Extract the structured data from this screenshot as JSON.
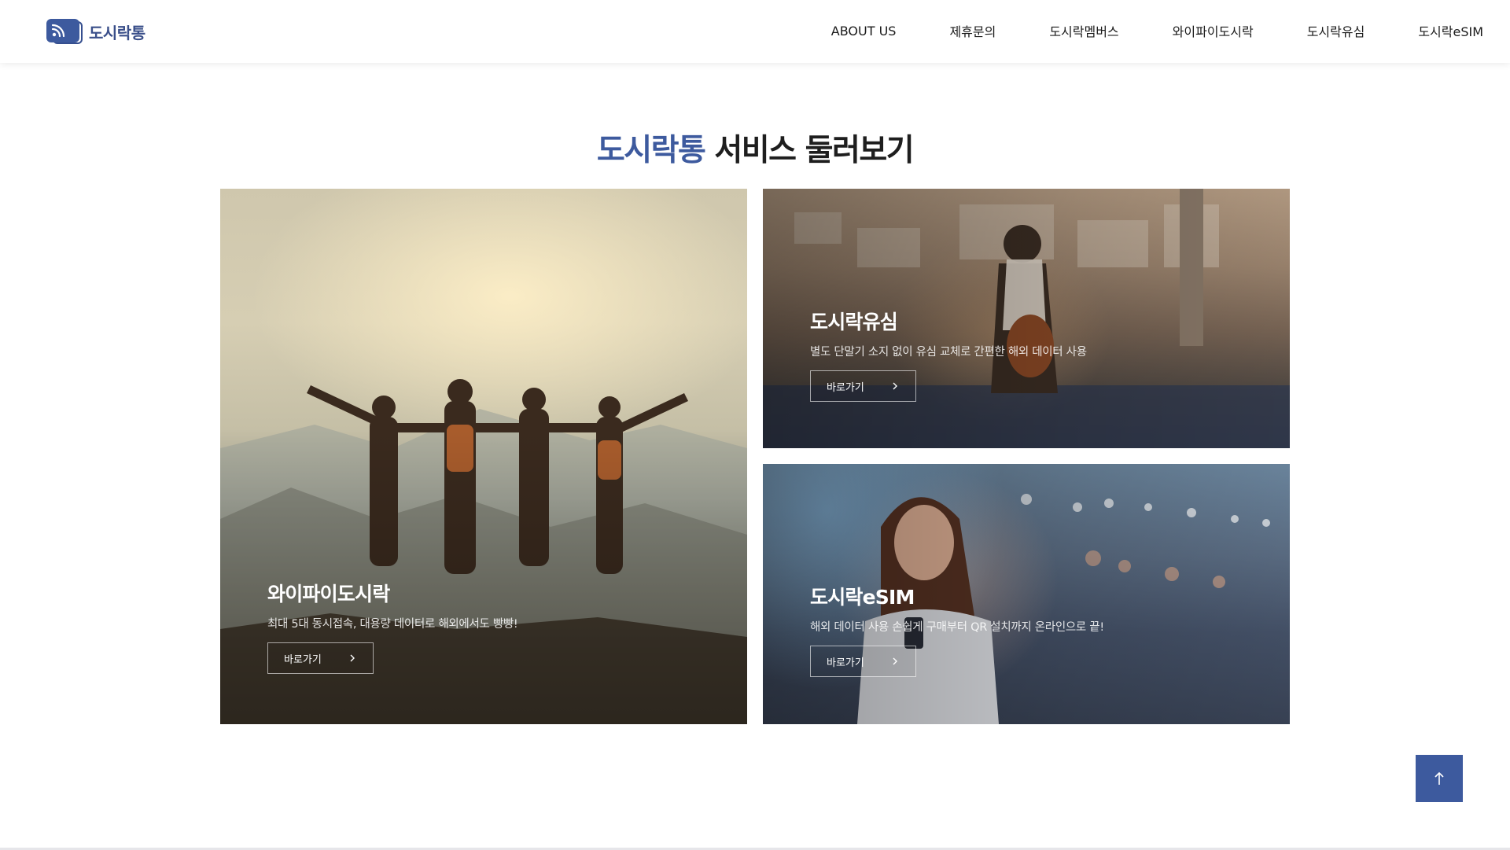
{
  "header": {
    "logo_text": "도시락통",
    "nav": [
      {
        "label": "ABOUT US"
      },
      {
        "label": "제휴문의"
      },
      {
        "label": "도시락멤버스"
      },
      {
        "label": "와이파이도시락"
      },
      {
        "label": "도시락유심"
      },
      {
        "label": "도시락eSIM"
      }
    ]
  },
  "section": {
    "title_accent": "도시락통",
    "title_rest": " 서비스 둘러보기"
  },
  "cards": [
    {
      "title": "와이파이도시락",
      "description": "최대 5대 동시접속, 대용량 데이터로 해외에서도 빵빵!",
      "button": "바로가기"
    },
    {
      "title": "도시락유심",
      "description": "별도 단말기 소지 없이 유심 교체로 간편한 해외 데이터 사용",
      "button": "바로가기"
    },
    {
      "title": "도시락eSIM",
      "description": "해외 데이터 사용 손쉽게 구매부터 QR 설치까지 온라인으로 끝!",
      "button": "바로가기"
    }
  ],
  "icons": {
    "logo": "rss-card-icon",
    "button_arrow": "chevron-right-icon",
    "scroll_top": "arrow-up-icon"
  },
  "colors": {
    "brand": "#3d5a9e",
    "text": "#1e1e1e",
    "background": "#ffffff"
  }
}
